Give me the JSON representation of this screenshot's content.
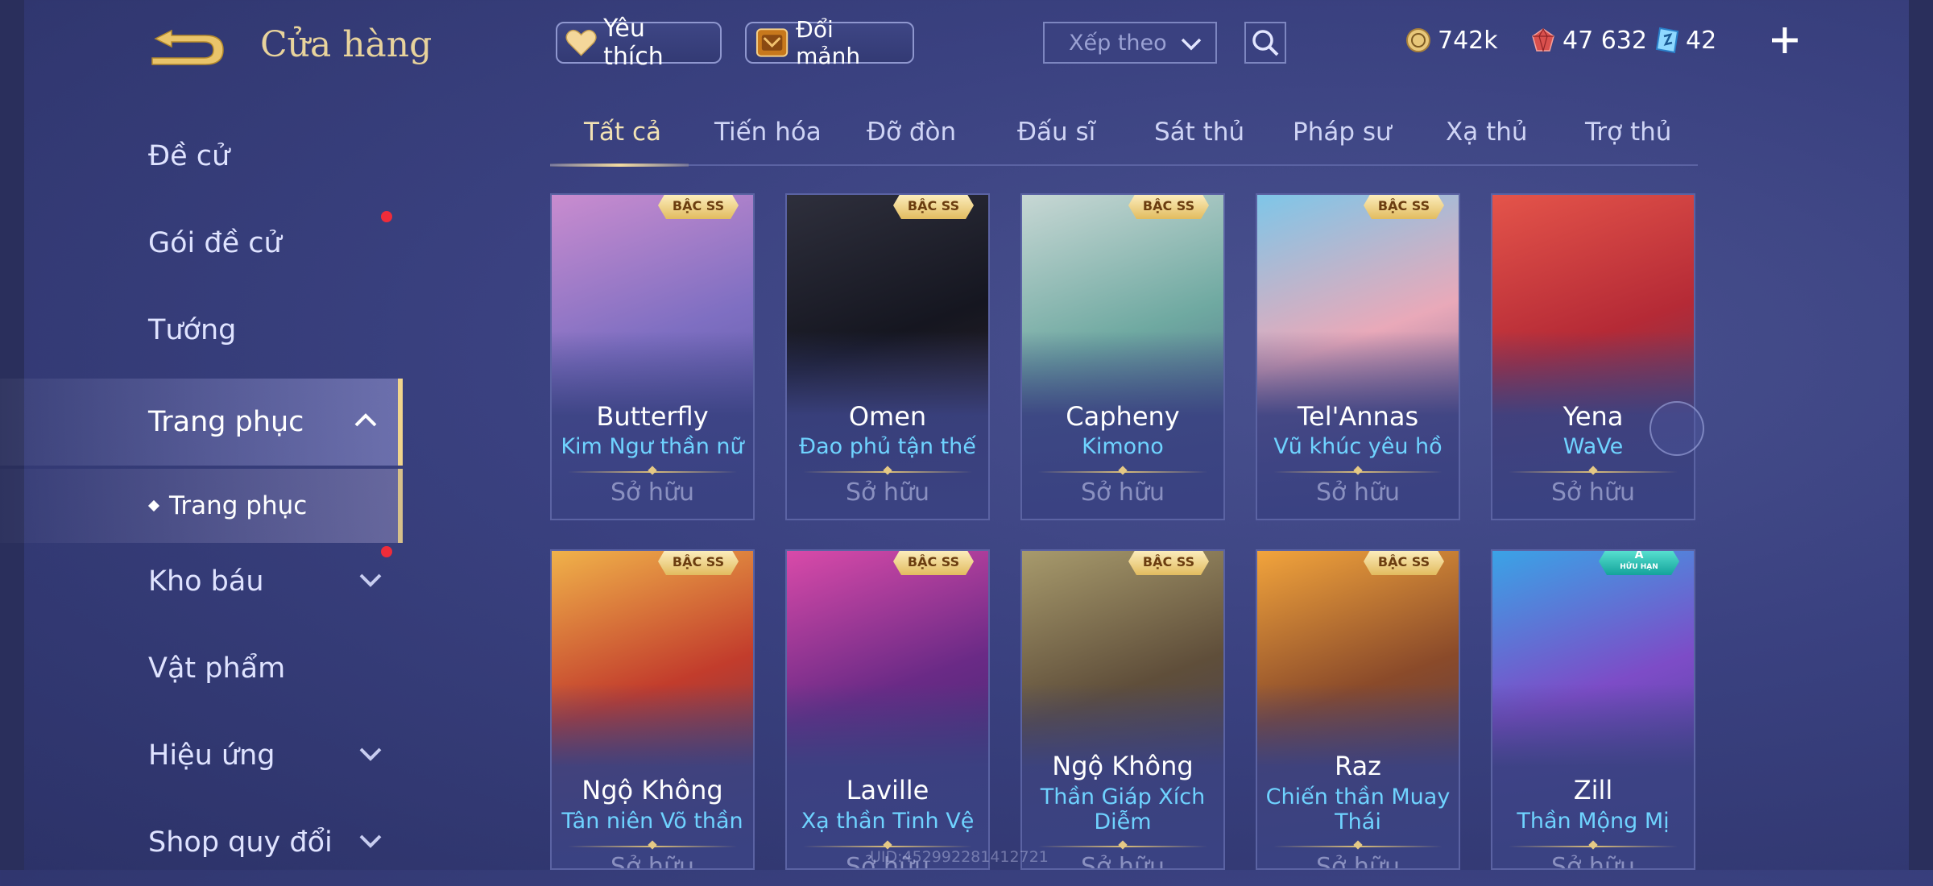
{
  "header": {
    "title": "Cửa hàng",
    "favorite_label": "Yêu thích",
    "exchange_label": "Đổi mảnh",
    "sort_placeholder": "Xếp theo"
  },
  "currencies": {
    "gold": "742k",
    "ruby": "47 632",
    "voucher": "42"
  },
  "sidebar": {
    "items": [
      {
        "label": "Đề cử"
      },
      {
        "label": "Gói đề cử"
      },
      {
        "label": "Tướng"
      },
      {
        "label": "Trang phục"
      },
      {
        "label": "Kho báu"
      },
      {
        "label": "Vật phẩm"
      },
      {
        "label": "Hiệu ứng"
      },
      {
        "label": "Shop quy đổi"
      }
    ],
    "sub_item": "Trang phục"
  },
  "tabs": [
    "Tất cả",
    "Tiến hóa",
    "Đỡ đòn",
    "Đấu sĩ",
    "Sát thủ",
    "Pháp sư",
    "Xạ thủ",
    "Trợ thủ"
  ],
  "cards": [
    {
      "hero": "Butterfly",
      "skin": "Kim Ngư thần nữ",
      "status": "Sở hữu",
      "badge": "BẬC SS",
      "colors": [
        "#c98ccf",
        "#7f6fc2",
        "#4b4f9a"
      ]
    },
    {
      "hero": "Omen",
      "skin": "Đao phủ tận thế",
      "status": "Sở hữu",
      "badge": "BẬC SS",
      "colors": [
        "#2e2f3c",
        "#151620",
        "#3c2c2c"
      ]
    },
    {
      "hero": "Capheny",
      "skin": "Kimono",
      "status": "Sở hữu",
      "badge": "BẬC SS",
      "colors": [
        "#c7d7d4",
        "#6fa9a1",
        "#3c4f7a"
      ]
    },
    {
      "hero": "Tel'Annas",
      "skin": "Vũ khúc yêu hồ",
      "status": "Sở hữu",
      "badge": "BẬC SS",
      "colors": [
        "#7ec6e8",
        "#e9a9b9",
        "#4b3f7c"
      ]
    },
    {
      "hero": "Yena",
      "skin": "WaVe",
      "status": "Sở hữu",
      "badge": "",
      "colors": [
        "#e4544a",
        "#b52a36",
        "#41406f"
      ]
    },
    {
      "hero": "Ngộ Không",
      "skin": "Tân niên Võ thần",
      "status": "Sở hữu",
      "badge": "BẬC SS",
      "colors": [
        "#f0b24a",
        "#c23c2c",
        "#3f3b6a"
      ]
    },
    {
      "hero": "Laville",
      "skin": "Xạ thần Tinh Vệ",
      "status": "Sở hữu",
      "badge": "BẬC SS",
      "colors": [
        "#d94aa9",
        "#6a2a86",
        "#2d2f68"
      ]
    },
    {
      "hero": "Ngộ Không",
      "skin": "Thần Giáp Xích Diễm",
      "status": "Sở hữu",
      "badge": "BẬC SS",
      "colors": [
        "#a79a6c",
        "#5f4e3a",
        "#3a3b6a"
      ]
    },
    {
      "hero": "Raz",
      "skin": "Chiến thần Muay Thái",
      "status": "Sở hữu",
      "badge": "BẬC SS",
      "colors": [
        "#f2a43c",
        "#8a4a2a",
        "#3b3a68"
      ]
    },
    {
      "hero": "Zill",
      "skin": "Thần Mộng Mị",
      "status": "Sở hữu",
      "badge": "A",
      "badge_sub": "HỮU HẠN",
      "colors": [
        "#3aa3e6",
        "#7d4cc7",
        "#3c3f86"
      ]
    }
  ],
  "uid_text": "UID:452992281412721"
}
